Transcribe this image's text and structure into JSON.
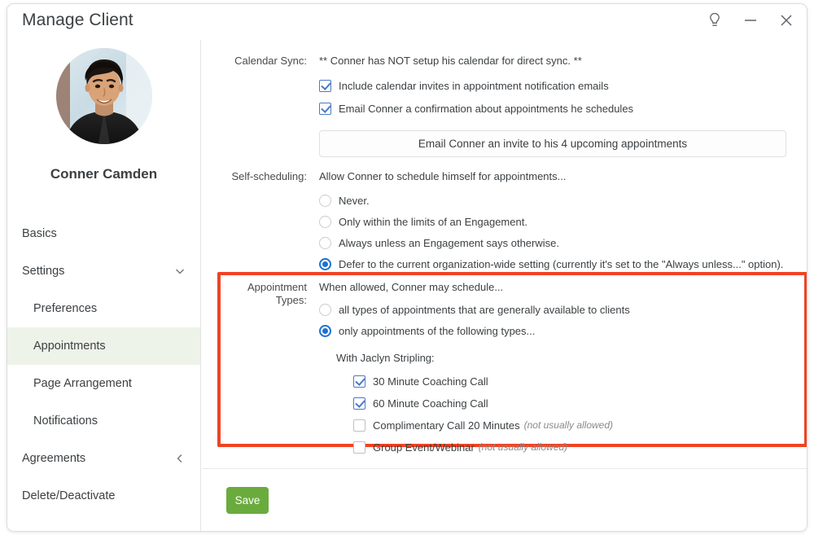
{
  "window": {
    "title": "Manage Client",
    "controls": [
      {
        "name": "help-idea-icon",
        "glyph": "lightbulb"
      },
      {
        "name": "minimize-icon",
        "glyph": "minus"
      },
      {
        "name": "close-icon",
        "glyph": "x"
      }
    ]
  },
  "sidebar": {
    "client_name": "Conner Camden",
    "items": [
      {
        "label": "Basics",
        "sub": false,
        "active": false,
        "chevron": ""
      },
      {
        "label": "Settings",
        "sub": false,
        "active": false,
        "chevron": "down"
      },
      {
        "label": "Preferences",
        "sub": true,
        "active": false,
        "chevron": ""
      },
      {
        "label": "Appointments",
        "sub": true,
        "active": true,
        "chevron": ""
      },
      {
        "label": "Page Arrangement",
        "sub": true,
        "active": false,
        "chevron": ""
      },
      {
        "label": "Notifications",
        "sub": true,
        "active": false,
        "chevron": ""
      },
      {
        "label": "Agreements",
        "sub": false,
        "active": false,
        "chevron": "left"
      },
      {
        "label": "Delete/Deactivate",
        "sub": false,
        "active": false,
        "chevron": ""
      }
    ]
  },
  "calendar_sync": {
    "label": "Calendar Sync:",
    "note": "** Conner has NOT setup his calendar for direct sync. **",
    "checkboxes": [
      {
        "label": "Include calendar invites in appointment notification emails",
        "checked": true
      },
      {
        "label": "Email Conner a confirmation about appointments he schedules",
        "checked": true
      }
    ],
    "invite_button": "Email Conner an invite to his 4 upcoming appointments"
  },
  "self_scheduling": {
    "label": "Self-scheduling:",
    "intro": "Allow Conner to schedule himself for appointments...",
    "options": [
      {
        "label": "Never.",
        "selected": false
      },
      {
        "label": "Only within the limits of an Engagement.",
        "selected": false
      },
      {
        "label": "Always unless an Engagement says otherwise.",
        "selected": false
      },
      {
        "label": "Defer to the current organization-wide setting (currently it's set to the \"Always unless...\" option).",
        "selected": true
      }
    ]
  },
  "appointment_types": {
    "label_line1": "Appointment",
    "label_line2": "Types:",
    "intro": "When allowed, Conner may schedule...",
    "options": [
      {
        "label": "all types of appointments that are generally available to clients",
        "selected": false
      },
      {
        "label": "only appointments of the following types...",
        "selected": true
      }
    ],
    "provider_heading": "With Jaclyn Stripling:",
    "types": [
      {
        "label": "30 Minute Coaching Call",
        "checked": true,
        "note": ""
      },
      {
        "label": "60 Minute Coaching Call",
        "checked": true,
        "note": ""
      },
      {
        "label": "Complimentary Call 20 Minutes",
        "checked": false,
        "note": "(not usually allowed)"
      },
      {
        "label": "Group Event/Webinar",
        "checked": false,
        "note": "(not usually allowed)"
      }
    ]
  },
  "footer": {
    "save_label": "Save"
  },
  "colors": {
    "accent_green": "#6aab3d",
    "highlight_red": "#ef4323",
    "nav_active_bg": "#eef3e9",
    "checkbox_blue": "#4a79c7",
    "radio_blue": "#1a73d1"
  }
}
